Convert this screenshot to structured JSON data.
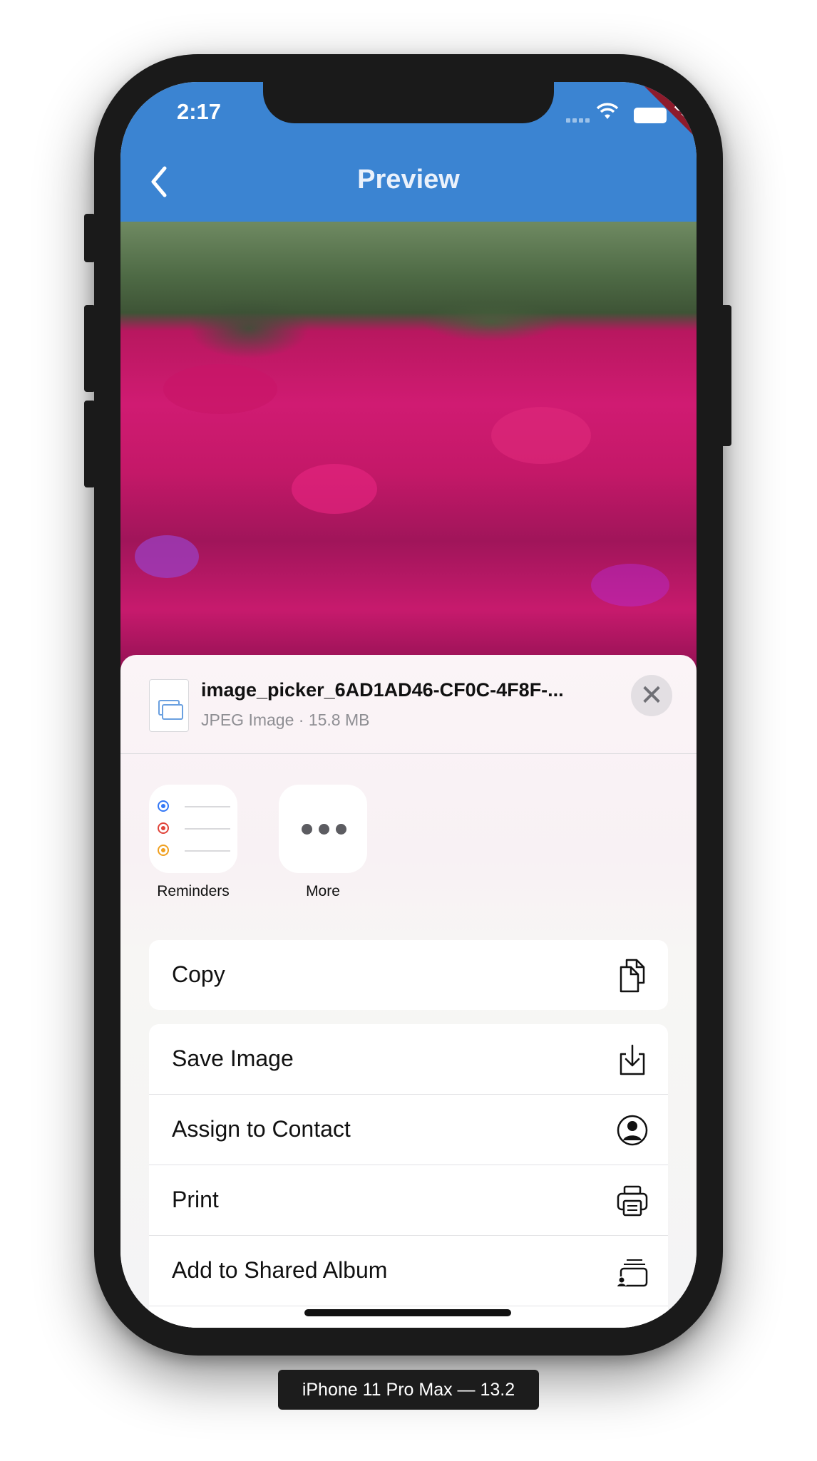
{
  "status_bar": {
    "time": "2:17",
    "debug_banner": "DEBUG"
  },
  "app_bar": {
    "title": "Preview",
    "back_icon": "chevron-left-icon"
  },
  "share_sheet": {
    "file_name": "image_picker_6AD1AD46-CF0C-4F8F-...",
    "file_meta": "JPEG Image · 15.8 MB",
    "close_icon": "close-icon",
    "apps": [
      {
        "label": "Reminders",
        "icon": "reminders-icon"
      },
      {
        "label": "More",
        "icon": "more-icon"
      }
    ],
    "actions_primary": [
      {
        "label": "Copy",
        "icon": "copy-icon"
      }
    ],
    "actions_secondary": [
      {
        "label": "Save Image",
        "icon": "save-image-icon"
      },
      {
        "label": "Assign to Contact",
        "icon": "contact-icon"
      },
      {
        "label": "Print",
        "icon": "printer-icon"
      },
      {
        "label": "Add to Shared Album",
        "icon": "shared-album-icon"
      }
    ]
  },
  "device_label": "iPhone 11 Pro Max — 13.2",
  "colors": {
    "app_bar": "#3b84d2",
    "reminder_blue": "#3478f6",
    "reminder_red": "#e0443a",
    "reminder_orange": "#f0a020"
  }
}
